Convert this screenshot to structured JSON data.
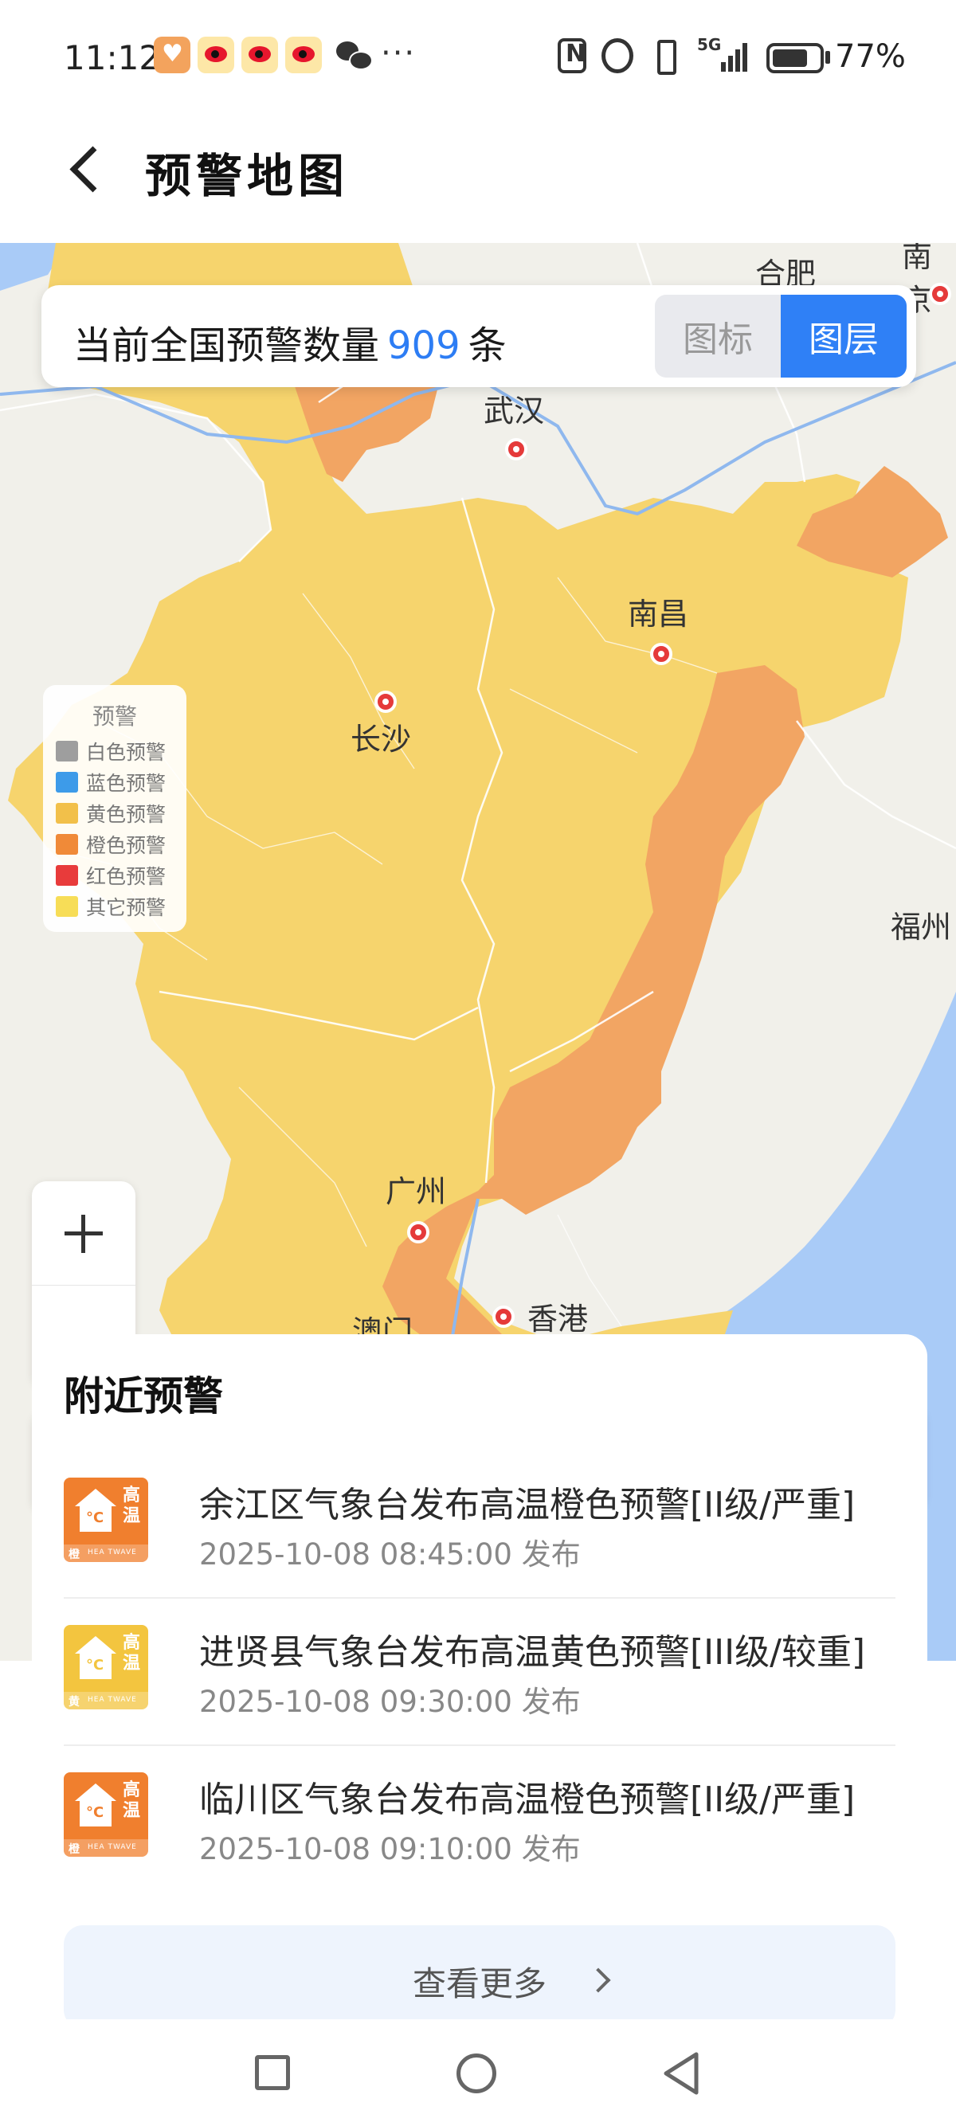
{
  "status_bar": {
    "time": "11:12",
    "notification_icons": [
      "heart-app-icon",
      "weibo-icon",
      "weibo-icon",
      "weibo-icon",
      "wechat-icon"
    ],
    "more": "···",
    "network": "5G",
    "battery_level": 0.77,
    "battery_text": "77%"
  },
  "header": {
    "title": "预警地图"
  },
  "map": {
    "count_prefix": "当前全国预警数量",
    "count_value": "909",
    "count_suffix": "条",
    "toggle": {
      "icon_label": "图标",
      "layer_label": "图层",
      "active": "layer_label"
    },
    "legend": {
      "title": "预警",
      "items": [
        {
          "label": "白色预警",
          "color": "#9e9e9e"
        },
        {
          "label": "蓝色预警",
          "color": "#3d9be9"
        },
        {
          "label": "黄色预警",
          "color": "#f2c04a"
        },
        {
          "label": "橙色预警",
          "color": "#f08a38"
        },
        {
          "label": "红色预警",
          "color": "#e83b3b"
        },
        {
          "label": "其它预警",
          "color": "#f7dd57"
        }
      ]
    },
    "cities": {
      "hefei": "合肥",
      "nanjing": "南京",
      "wuhan": "武汉",
      "nanchang": "南昌",
      "changsha": "长沙",
      "fuzhou": "福州",
      "guangzhou": "广州",
      "hongkong": "香港",
      "macau": "澳门"
    },
    "colors": {
      "yellow_area": "#f6d46d",
      "orange_area": "#f2a563",
      "land": "#f1f0ea",
      "sea": "#a9cbf7",
      "river": "#8fb8ee"
    }
  },
  "nearby": {
    "title": "附近预警",
    "items": [
      {
        "title": "余江区气象台发布高温橙色预警[II级/严重]",
        "time": "2025-10-08 08:45:00 发布",
        "level": "橙",
        "color": "#f07f2e",
        "icon_text": "高温",
        "icon_en": "HEA TWAVE"
      },
      {
        "title": "进贤县气象台发布高温黄色预警[III级/较重]",
        "time": "2025-10-08 09:30:00 发布",
        "level": "黄",
        "color": "#f3c53f",
        "icon_text": "高温",
        "icon_en": "HEA TWAVE"
      },
      {
        "title": "临川区气象台发布高温橙色预警[II级/严重]",
        "time": "2025-10-08 09:10:00 发布",
        "level": "橙",
        "color": "#f07f2e",
        "icon_text": "高温",
        "icon_en": "HEA TWAVE"
      }
    ],
    "more_label": "查看更多"
  }
}
